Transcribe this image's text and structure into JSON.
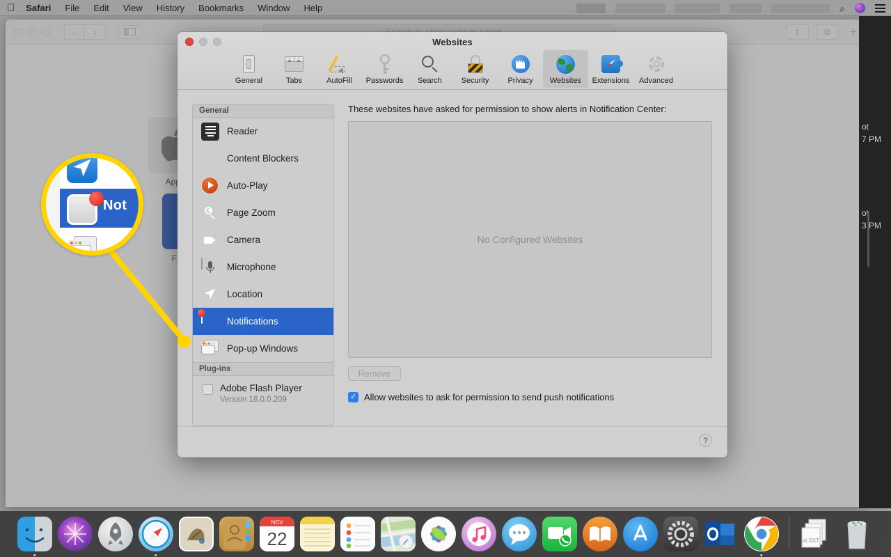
{
  "menubar": {
    "apple_glyph": "",
    "items": [
      {
        "label": "Safari",
        "bold": true
      },
      {
        "label": "File",
        "bold": false
      },
      {
        "label": "Edit",
        "bold": false
      },
      {
        "label": "View",
        "bold": false
      },
      {
        "label": "History",
        "bold": false
      },
      {
        "label": "Bookmarks",
        "bold": false
      },
      {
        "label": "Window",
        "bold": false
      },
      {
        "label": "Help",
        "bold": false
      }
    ],
    "right_icons": [
      "search-icon",
      "siri-icon",
      "control-center-icon"
    ],
    "search_glyph": "⌕"
  },
  "safari_window": {
    "urlbar": {
      "placeholder": "Search or enter website name",
      "value": "",
      "search_glyph": "⌕"
    },
    "back_glyph": "‹",
    "forward_glyph": "›",
    "share_glyph": "⇧",
    "tabs_glyph": "⧉",
    "new_tab_glyph": "+",
    "favorites": [
      {
        "label": "Apple",
        "icon": "apple-logo-icon"
      },
      {
        "label": "Facebook",
        "icon": "facebook-icon"
      }
    ],
    "notifications_panel": [
      {
        "title": "ot",
        "time": "7 PM"
      },
      {
        "title": "ot",
        "time": "3 PM"
      }
    ]
  },
  "prefs": {
    "title": "Websites",
    "traffic_lights": [
      "close-button",
      "minimize-button",
      "zoom-button"
    ],
    "toolbar": [
      {
        "label": "General",
        "icon": "general-icon",
        "selected": false
      },
      {
        "label": "Tabs",
        "icon": "tabs-icon",
        "selected": false
      },
      {
        "label": "AutoFill",
        "icon": "autofill-icon",
        "selected": false
      },
      {
        "label": "Passwords",
        "icon": "key-icon",
        "selected": false
      },
      {
        "label": "Search",
        "icon": "search-icon",
        "selected": false
      },
      {
        "label": "Security",
        "icon": "lock-icon",
        "selected": false
      },
      {
        "label": "Privacy",
        "icon": "hand-icon",
        "selected": false
      },
      {
        "label": "Websites",
        "icon": "globe-icon",
        "selected": true
      },
      {
        "label": "Extensions",
        "icon": "puzzle-icon",
        "selected": false
      },
      {
        "label": "Advanced",
        "icon": "gear-icon",
        "selected": false
      }
    ],
    "sidebar": {
      "general_header": "General",
      "general_items": [
        {
          "label": "Reader",
          "icon": "reader-icon",
          "selected": false
        },
        {
          "label": "Content Blockers",
          "icon": "stop-sign-icon",
          "selected": false
        },
        {
          "label": "Auto-Play",
          "icon": "play-icon",
          "selected": false
        },
        {
          "label": "Page Zoom",
          "icon": "magnifier-plus-icon",
          "selected": false
        },
        {
          "label": "Camera",
          "icon": "camera-icon",
          "selected": false
        },
        {
          "label": "Microphone",
          "icon": "microphone-icon",
          "selected": false
        },
        {
          "label": "Location",
          "icon": "location-arrow-icon",
          "selected": false
        },
        {
          "label": "Notifications",
          "icon": "notifications-icon",
          "selected": true
        },
        {
          "label": "Pop-up Windows",
          "icon": "popup-windows-icon",
          "selected": false
        }
      ],
      "plugins_header": "Plug-ins",
      "plugins": [
        {
          "name": "Adobe Flash Player",
          "version": "Version 18.0.0.209",
          "checked": false
        }
      ]
    },
    "pane": {
      "description": "These websites have asked for permission to show alerts in Notification Center:",
      "empty_state": "No Configured Websites",
      "remove_label": "Remove",
      "remove_disabled": true,
      "allow_checkbox_label": "Allow websites to ask for permission to send push notifications",
      "allow_checkbox_checked": true,
      "check_glyph": "✓",
      "help_glyph": "?"
    }
  },
  "callout": {
    "magnifier_label": "Not",
    "highlight_color": "#FFD400",
    "target": "notifications-sidebar-row"
  },
  "dock": {
    "items": [
      {
        "name": "finder",
        "running": true
      },
      {
        "name": "siri",
        "running": false
      },
      {
        "name": "launchpad",
        "running": false
      },
      {
        "name": "safari",
        "running": true
      },
      {
        "name": "mail",
        "running": false
      },
      {
        "name": "contacts",
        "running": false
      },
      {
        "name": "calendar",
        "running": false,
        "month": "NOV",
        "day": "22"
      },
      {
        "name": "notes",
        "running": false
      },
      {
        "name": "reminders",
        "running": false
      },
      {
        "name": "maps",
        "running": false
      },
      {
        "name": "photos",
        "running": false
      },
      {
        "name": "itunes",
        "running": false
      },
      {
        "name": "messages",
        "running": false
      },
      {
        "name": "facetime",
        "running": false
      },
      {
        "name": "ibooks",
        "running": false
      },
      {
        "name": "app-store",
        "running": false
      },
      {
        "name": "system-preferences",
        "running": false
      },
      {
        "name": "outlook",
        "running": false
      },
      {
        "name": "chrome",
        "running": true
      }
    ],
    "stack_label": "xLSXT",
    "trash_name": "trash"
  }
}
